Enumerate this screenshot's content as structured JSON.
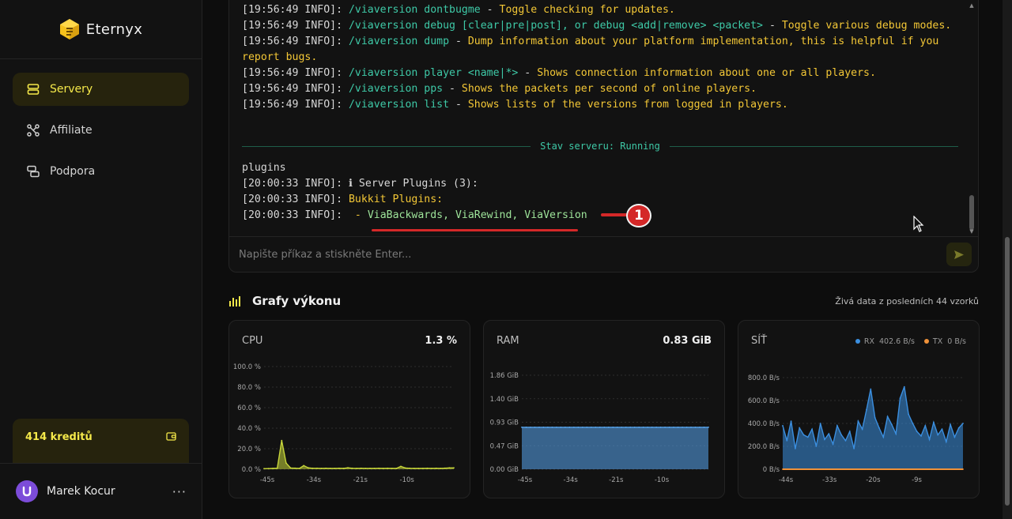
{
  "brand": {
    "name": "Eternyx"
  },
  "sidebar": {
    "items": [
      {
        "label": "Servery",
        "active": true
      },
      {
        "label": "Affiliate",
        "active": false
      },
      {
        "label": "Podpora",
        "active": false
      }
    ],
    "credits": "414 kreditů",
    "user": "Marek Kocur",
    "more": "···"
  },
  "console": {
    "lines": [
      [
        [
          "[19:56:49 INFO]: ",
          "w"
        ],
        [
          "/viaversion dontbugme",
          "c"
        ],
        [
          " - ",
          "w"
        ],
        [
          "Toggle checking for updates.",
          "y"
        ]
      ],
      [
        [
          "[19:56:49 INFO]: ",
          "w"
        ],
        [
          "/viaversion debug [clear|pre|post], or debug <add|remove> <packet>",
          "c"
        ],
        [
          " - ",
          "w"
        ],
        [
          "Toggle various debug modes.",
          "y"
        ]
      ],
      [
        [
          "[19:56:49 INFO]: ",
          "w"
        ],
        [
          "/viaversion dump",
          "c"
        ],
        [
          " - ",
          "w"
        ],
        [
          "Dump information about your platform implementation, this is helpful if you report bugs.",
          "y"
        ]
      ],
      [
        [
          "[19:56:49 INFO]: ",
          "w"
        ],
        [
          "/viaversion player <name|*>",
          "c"
        ],
        [
          " - ",
          "w"
        ],
        [
          "Shows connection information about one or all players.",
          "y"
        ]
      ],
      [
        [
          "[19:56:49 INFO]: ",
          "w"
        ],
        [
          "/viaversion pps",
          "c"
        ],
        [
          " - ",
          "w"
        ],
        [
          "Shows the packets per second of online players.",
          "y"
        ]
      ],
      [
        [
          "[19:56:49 INFO]: ",
          "w"
        ],
        [
          "/viaversion list",
          "c"
        ],
        [
          " - ",
          "w"
        ],
        [
          "Shows lists of the versions from logged in players.",
          "y"
        ]
      ]
    ],
    "status": "Stav serveru: Running",
    "after": [
      [
        [
          "plugins",
          "w"
        ]
      ],
      [
        [
          "[20:00:33 INFO]: ",
          "w"
        ],
        [
          "ℹ Server Plugins (3):",
          "w"
        ]
      ],
      [
        [
          "[20:00:33 INFO]: ",
          "w"
        ],
        [
          "Bukkit Plugins:",
          "y"
        ]
      ],
      [
        [
          "[20:00:33 INFO]: ",
          "w"
        ],
        [
          " - ",
          "y"
        ],
        [
          "ViaBackwards, ViaRewind, ViaVersion",
          "g"
        ]
      ]
    ],
    "input_placeholder": "Napište příkaz a stiskněte Enter..."
  },
  "annotation": {
    "badge": "1"
  },
  "performance": {
    "title": "Grafy výkonu",
    "subtitle": "Živá data z posledních 44 vzorků"
  },
  "colors": {
    "accent": "#f5e94a",
    "cpu": "#c8d73a",
    "ram": "#3b8fe0",
    "rx": "#3b8fe0",
    "tx": "#f0923a",
    "annotation": "#d42828"
  },
  "chart_data": [
    {
      "type": "area",
      "title": "CPU",
      "current": "1.3 %",
      "yticks": [
        "100.0 %",
        "80.0 %",
        "60.0 %",
        "40.0 %",
        "20.0 %",
        "0.0 %"
      ],
      "ylim": [
        0,
        100
      ],
      "xticks": [
        "-45s",
        "-34s",
        "-21s",
        "-10s"
      ],
      "series": [
        {
          "values": [
            0.5,
            0.6,
            0.8,
            1.0,
            28,
            6,
            1.2,
            1.0,
            0.8,
            3.5,
            1.4,
            0.9,
            0.9,
            0.8,
            0.9,
            0.8,
            0.8,
            0.9,
            0.8,
            1.4,
            0.9,
            0.8,
            0.9,
            0.8,
            0.8,
            0.8,
            0.9,
            0.8,
            0.9,
            0.8,
            0.8,
            2.8,
            1.2,
            0.9,
            0.8,
            0.8,
            0.8,
            0.9,
            0.8,
            0.9,
            0.8,
            1.0,
            1.3,
            1.3
          ]
        }
      ]
    },
    {
      "type": "area",
      "title": "RAM",
      "current": "0.83 GiB",
      "yticks": [
        "1.86 GiB",
        "1.40 GiB",
        "0.93 GiB",
        "0.47 GiB",
        "0.00 GiB"
      ],
      "ylim": [
        0,
        1.86
      ],
      "xticks": [
        "-45s",
        "-34s",
        "-21s",
        "-10s"
      ],
      "series": [
        {
          "values": [
            0.83,
            0.83,
            0.83,
            0.83,
            0.83,
            0.83,
            0.83,
            0.83,
            0.83,
            0.83,
            0.83,
            0.83,
            0.83,
            0.83,
            0.83,
            0.83,
            0.83,
            0.83,
            0.83,
            0.83,
            0.83,
            0.83,
            0.83,
            0.83,
            0.83,
            0.83,
            0.83,
            0.83,
            0.83,
            0.83,
            0.83,
            0.83,
            0.83,
            0.83,
            0.83,
            0.83,
            0.83,
            0.83,
            0.83,
            0.83,
            0.83,
            0.83,
            0.83,
            0.83
          ]
        }
      ]
    },
    {
      "type": "area",
      "title": "SÍŤ",
      "legend": [
        {
          "name": "RX",
          "value": "402.6 B/s"
        },
        {
          "name": "TX",
          "value": "0 B/s"
        }
      ],
      "yticks": [
        "800.0 B/s",
        "600.0 B/s",
        "400.0 B/s",
        "200.0 B/s",
        "0 B/s"
      ],
      "ylim": [
        0,
        800
      ],
      "xticks": [
        "-44s",
        "-33s",
        "-20s",
        "-9s"
      ],
      "series": [
        {
          "name": "RX",
          "values": [
            380,
            250,
            420,
            180,
            360,
            300,
            280,
            350,
            200,
            400,
            260,
            310,
            220,
            380,
            300,
            250,
            330,
            180,
            420,
            350,
            520,
            700,
            450,
            360,
            280,
            460,
            390,
            310,
            620,
            720,
            480,
            400,
            330,
            290,
            380,
            260,
            410,
            300,
            350,
            240,
            390,
            280,
            360,
            400
          ]
        },
        {
          "name": "TX",
          "values": [
            0,
            0,
            0,
            0,
            0,
            0,
            0,
            0,
            0,
            0,
            0,
            0,
            0,
            0,
            0,
            0,
            0,
            0,
            0,
            0,
            0,
            0,
            0,
            0,
            0,
            0,
            0,
            0,
            0,
            0,
            0,
            0,
            0,
            0,
            0,
            0,
            0,
            0,
            0,
            0,
            0,
            0,
            0,
            0
          ]
        }
      ]
    }
  ]
}
